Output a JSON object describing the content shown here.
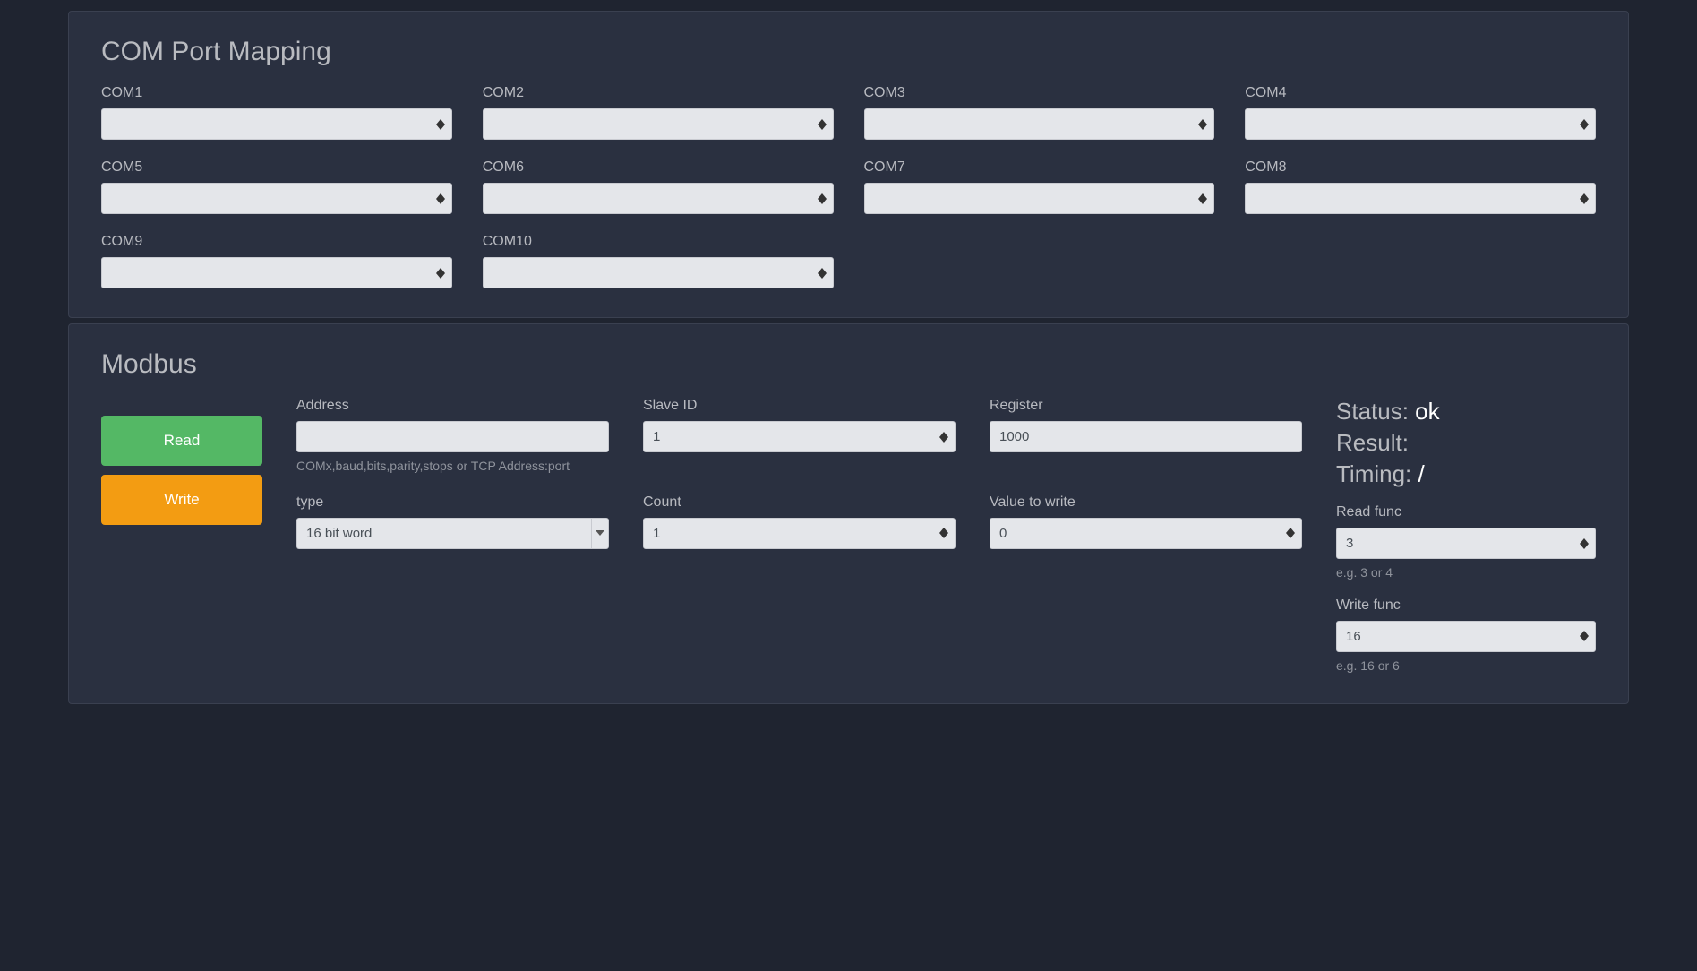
{
  "com_mapping": {
    "title": "COM Port Mapping",
    "ports": [
      {
        "label": "COM1",
        "value": ""
      },
      {
        "label": "COM2",
        "value": ""
      },
      {
        "label": "COM3",
        "value": ""
      },
      {
        "label": "COM4",
        "value": ""
      },
      {
        "label": "COM5",
        "value": ""
      },
      {
        "label": "COM6",
        "value": ""
      },
      {
        "label": "COM7",
        "value": ""
      },
      {
        "label": "COM8",
        "value": ""
      },
      {
        "label": "COM9",
        "value": ""
      },
      {
        "label": "COM10",
        "value": ""
      }
    ]
  },
  "modbus": {
    "title": "Modbus",
    "buttons": {
      "read": "Read",
      "write": "Write"
    },
    "address": {
      "label": "Address",
      "value": "",
      "help": "COMx,baud,bits,parity,stops or TCP Address:port"
    },
    "slave_id": {
      "label": "Slave ID",
      "value": "1"
    },
    "register": {
      "label": "Register",
      "value": "1000"
    },
    "type": {
      "label": "type",
      "value": "16 bit word"
    },
    "count": {
      "label": "Count",
      "value": "1"
    },
    "value_to_write": {
      "label": "Value to write",
      "value": "0"
    },
    "status": {
      "label": "Status:",
      "value": "ok"
    },
    "result": {
      "label": "Result:",
      "value": ""
    },
    "timing": {
      "label": "Timing:",
      "value": "/"
    },
    "read_func": {
      "label": "Read func",
      "value": "3",
      "help": "e.g. 3 or 4"
    },
    "write_func": {
      "label": "Write func",
      "value": "16",
      "help": "e.g. 16 or 6"
    }
  }
}
